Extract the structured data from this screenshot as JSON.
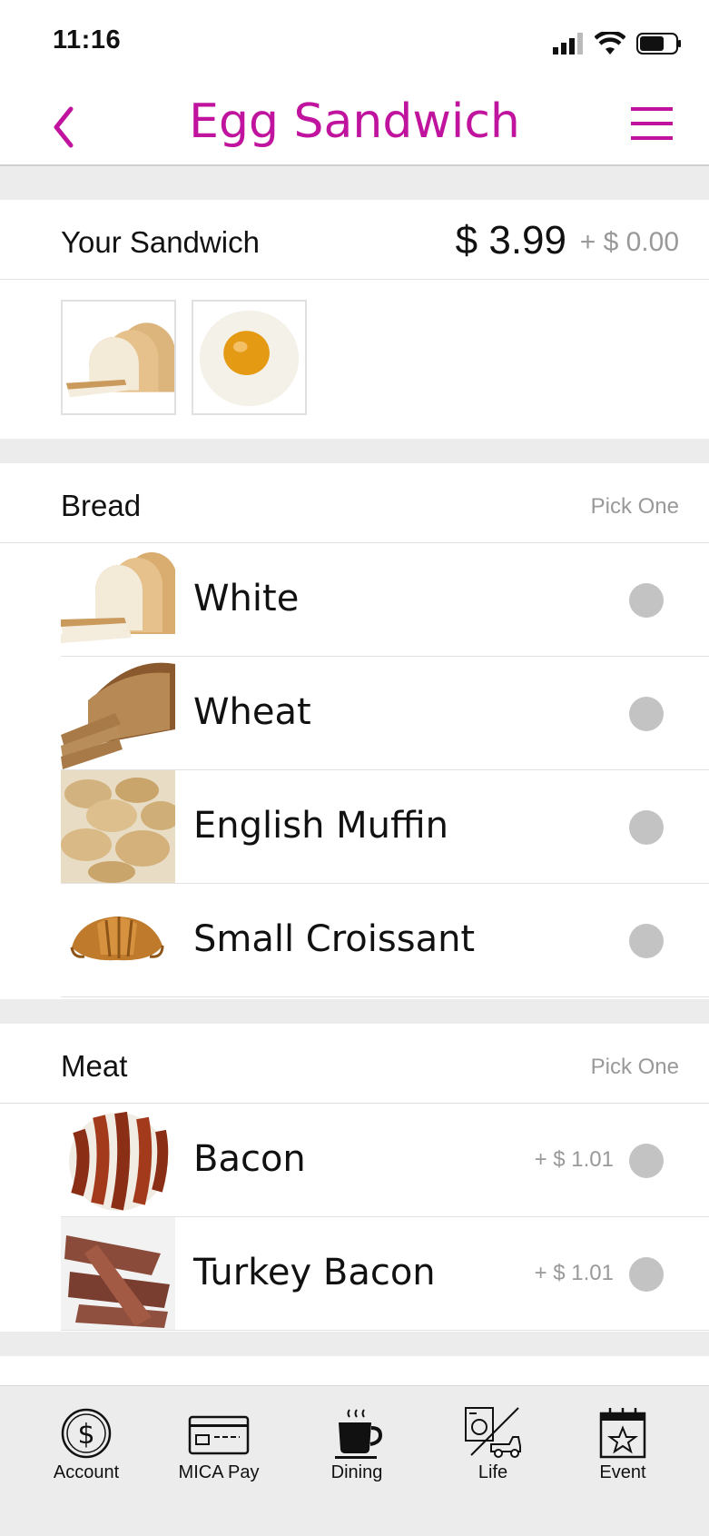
{
  "status_bar": {
    "time": "11:16"
  },
  "nav": {
    "title": "Egg Sandwich"
  },
  "summary": {
    "label": "Your Sandwich",
    "price": "$ 3.99",
    "extra": "+ $ 0.00",
    "thumbnails": [
      "white-bread",
      "fried-egg"
    ]
  },
  "bread": {
    "label": "Bread",
    "pick": "Pick One",
    "options": [
      {
        "name": "White",
        "image": "white-bread"
      },
      {
        "name": "Wheat",
        "image": "wheat-bread"
      },
      {
        "name": "English Muffin",
        "image": "english-muffin"
      },
      {
        "name": "Small Croissant",
        "image": "croissant"
      }
    ]
  },
  "meat": {
    "label": "Meat",
    "pick": "Pick One",
    "options": [
      {
        "name": "Bacon",
        "surcharge": "+ $ 1.01",
        "image": "bacon"
      },
      {
        "name": "Turkey Bacon",
        "surcharge": "+ $ 1.01",
        "image": "turkey-bacon"
      }
    ]
  },
  "tabs": [
    {
      "label": "Account",
      "icon": "dollar-circle-icon"
    },
    {
      "label": "MICA Pay",
      "icon": "credit-card-icon"
    },
    {
      "label": "Dining",
      "icon": "coffee-cup-icon"
    },
    {
      "label": "Life",
      "icon": "laundry-truck-icon"
    },
    {
      "label": "Event",
      "icon": "calendar-star-icon"
    }
  ],
  "colors": {
    "accent": "#c0149e",
    "muted": "#999999",
    "radio": "#c3c3c3"
  }
}
